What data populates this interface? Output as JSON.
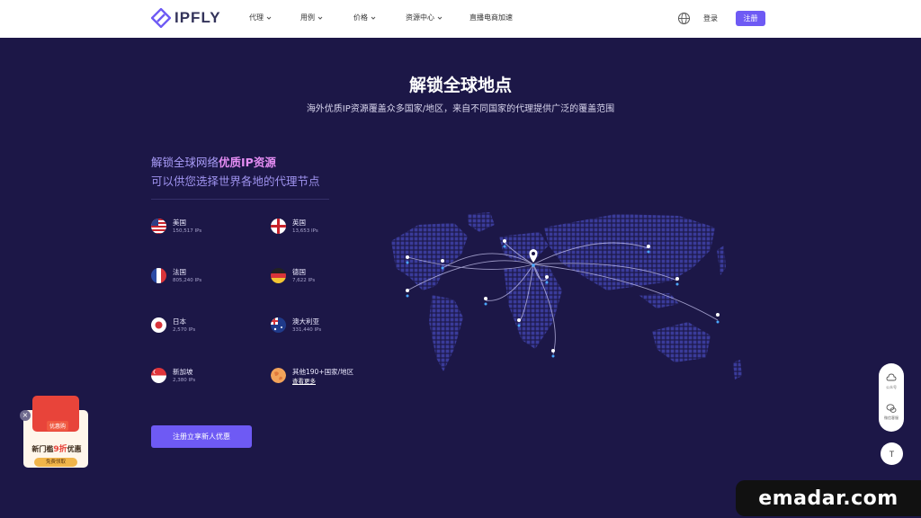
{
  "nav": {
    "logo_text": "IPFLY",
    "items": [
      {
        "label": "代理"
      },
      {
        "label": "用例"
      },
      {
        "label": "价格"
      },
      {
        "label": "资源中心"
      },
      {
        "label": "直播电商加速"
      }
    ],
    "login_label": "登录",
    "register_label": "注册"
  },
  "hero": {
    "title": "解锁全球地点",
    "subtitle": "海外优质IP资源覆盖众多国家/地区，来自不同国家的代理提供广泛的覆盖范围"
  },
  "lead": {
    "line1_prefix": "解锁全球网络",
    "line1_highlight": "优质IP资源",
    "line2": "可以供您选择世界各地的代理节点"
  },
  "countries": [
    {
      "name": "美国",
      "ips": "150,517 IPs",
      "flag": "us-flag"
    },
    {
      "name": "英国",
      "ips": "13,653 IPs",
      "flag": "uk-flag"
    },
    {
      "name": "法国",
      "ips": "805,240 IPs",
      "flag": "fr-flag"
    },
    {
      "name": "德国",
      "ips": "7,622 IPs",
      "flag": "de-flag"
    },
    {
      "name": "日本",
      "ips": "2,570 IPs",
      "flag": "jp-flag"
    },
    {
      "name": "澳大利亚",
      "ips": "331,440 IPs",
      "flag": "au-flag"
    },
    {
      "name": "新加坡",
      "ips": "2,380 IPs",
      "flag": "sg-flag"
    },
    {
      "name": "其他190+国家/地区",
      "link": "查看更多",
      "flag": "globe-flag"
    }
  ],
  "cta_label": "注册立享新人优惠",
  "promo": {
    "tag": "优惠购",
    "line_prefix": "新门槛",
    "line_highlight": "9折",
    "line_suffix": "优惠",
    "button": "免费领取"
  },
  "side": {
    "item1_label": "公众号",
    "item2_label": "微信客服",
    "top_label": "T"
  },
  "watermark": "emadar.com",
  "colors": {
    "background": "#1c1747",
    "accent": "#6e5af4",
    "highlight": "#e38cf2"
  }
}
